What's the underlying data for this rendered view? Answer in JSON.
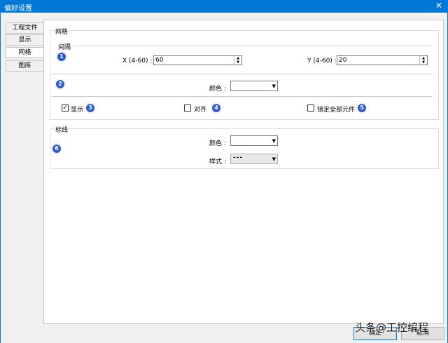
{
  "window": {
    "title": "偏好设置",
    "close": "✕"
  },
  "tabs": [
    "工程文件",
    "显示",
    "网格",
    "图库"
  ],
  "grid": {
    "title": "网格",
    "spacing_label": "间隔",
    "x_label": "X (4-60) :",
    "x_value": "60",
    "y_label": "Y (4-60) :",
    "y_value": "20",
    "color_label": "颜色 :",
    "show_label": "显示",
    "align_label": "对齐",
    "lock_label": "锁定全部元件",
    "show_checked": true,
    "align_checked": false,
    "lock_checked": false
  },
  "ruler": {
    "title": "标线",
    "color_label": "颜色 :",
    "style_label": "样式 :",
    "style_value": "---"
  },
  "markers": [
    "1",
    "2",
    "3",
    "4",
    "5",
    "6"
  ],
  "buttons": {
    "ok": "确定",
    "cancel": "取消"
  },
  "watermark": "头条@工控编程"
}
